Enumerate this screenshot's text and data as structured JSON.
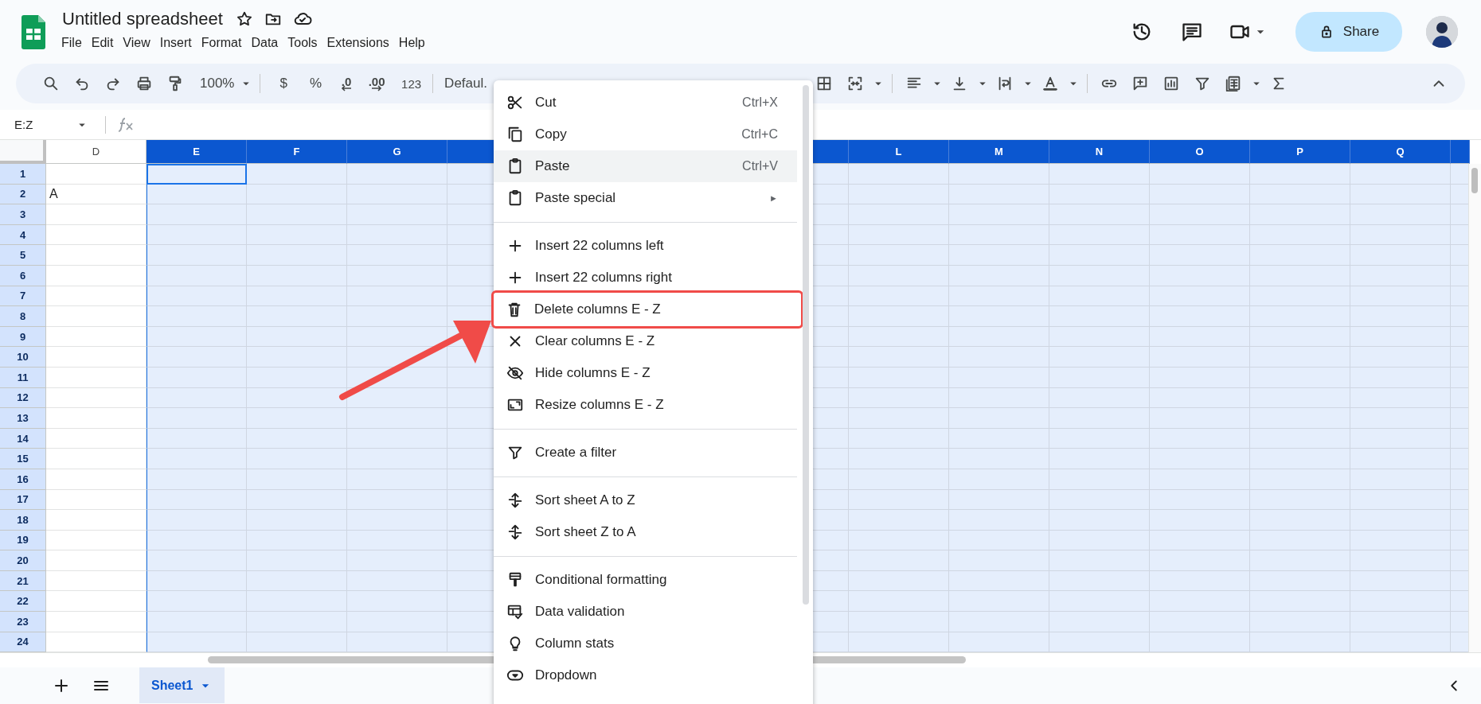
{
  "app": {
    "title": "Untitled spreadsheet"
  },
  "menubar": [
    "File",
    "Edit",
    "View",
    "Insert",
    "Format",
    "Data",
    "Tools",
    "Extensions",
    "Help"
  ],
  "share_button": {
    "label": "Share"
  },
  "toolbar": {
    "zoom": "100%",
    "currency": "$",
    "percent": "%",
    "decrease_decimal": ".0",
    "increase_decimal": ".00",
    "number_format": "123",
    "font": "Defaul."
  },
  "formula_bar": {
    "name_box": "E:Z"
  },
  "grid": {
    "columns": [
      {
        "label": "D",
        "selected": false
      },
      {
        "label": "E",
        "selected": true
      },
      {
        "label": "F",
        "selected": true
      },
      {
        "label": "G",
        "selected": true
      },
      {
        "selected": true
      },
      {
        "label": "L",
        "selected": true
      },
      {
        "label": "M",
        "selected": true
      },
      {
        "label": "N",
        "selected": true
      },
      {
        "label": "O",
        "selected": true
      },
      {
        "label": "P",
        "selected": true
      },
      {
        "label": "Q",
        "selected": true
      },
      {
        "selected": true
      }
    ],
    "rows": [
      {
        "label": "1",
        "cells": [
          {
            "active": false
          },
          {
            "active": true
          }
        ]
      },
      {
        "label": "2",
        "cells": [
          {
            "text": "A",
            "active": false
          }
        ]
      },
      {
        "label": "3"
      },
      {
        "label": "4"
      },
      {
        "label": "5"
      },
      {
        "label": "6"
      },
      {
        "label": "7"
      },
      {
        "label": "8"
      },
      {
        "label": "9"
      },
      {
        "label": "10"
      },
      {
        "label": "11"
      },
      {
        "label": "12"
      },
      {
        "label": "13"
      },
      {
        "label": "14"
      },
      {
        "label": "15"
      },
      {
        "label": "16"
      },
      {
        "label": "17"
      },
      {
        "label": "18"
      },
      {
        "label": "19"
      },
      {
        "label": "20"
      },
      {
        "label": "21"
      },
      {
        "label": "22"
      },
      {
        "label": "23"
      },
      {
        "label": "24"
      }
    ]
  },
  "context_menu": {
    "items": [
      {
        "kind": "item",
        "label": "Cut",
        "shortcut": "Ctrl+X",
        "hovered": false,
        "outlined": false
      },
      {
        "kind": "item",
        "label": "Copy",
        "shortcut": "Ctrl+C",
        "hovered": false,
        "outlined": false
      },
      {
        "kind": "item",
        "label": "Paste",
        "shortcut": "Ctrl+V",
        "hovered": true,
        "outlined": false
      },
      {
        "kind": "item",
        "label": "Paste special",
        "submenu_arrow": "►",
        "hovered": false,
        "outlined": false
      },
      {
        "kind": "separator"
      },
      {
        "kind": "item",
        "label": "Insert 22 columns left",
        "hovered": false,
        "outlined": false
      },
      {
        "kind": "item",
        "label": "Insert 22 columns right",
        "hovered": false,
        "outlined": false
      },
      {
        "kind": "item",
        "label": "Delete columns E - Z",
        "hovered": false,
        "outlined": true
      },
      {
        "kind": "item",
        "label": "Clear columns E - Z",
        "hovered": false,
        "outlined": false
      },
      {
        "kind": "item",
        "label": "Hide columns E - Z",
        "hovered": false,
        "outlined": false
      },
      {
        "kind": "item",
        "label": "Resize columns E - Z",
        "hovered": false,
        "outlined": false
      },
      {
        "kind": "separator"
      },
      {
        "kind": "item",
        "label": "Create a filter",
        "hovered": false,
        "outlined": false
      },
      {
        "kind": "separator"
      },
      {
        "kind": "item",
        "label": "Sort sheet A to Z",
        "hovered": false,
        "outlined": false
      },
      {
        "kind": "item",
        "label": "Sort sheet Z to A",
        "hovered": false,
        "outlined": false
      },
      {
        "kind": "separator"
      },
      {
        "kind": "item",
        "label": "Conditional formatting",
        "hovered": false,
        "outlined": false
      },
      {
        "kind": "item",
        "label": "Data validation",
        "hovered": false,
        "outlined": false
      },
      {
        "kind": "item",
        "label": "Column stats",
        "hovered": false,
        "outlined": false
      },
      {
        "kind": "item",
        "label": "Dropdown",
        "hovered": false,
        "outlined": false
      }
    ]
  },
  "sheet_tabs": [
    {
      "label": "Sheet1",
      "selected": true
    }
  ]
}
